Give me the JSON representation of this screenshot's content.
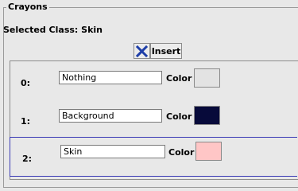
{
  "group": {
    "title": "Crayons"
  },
  "selected_class": "Selected Class: Skin",
  "toolbar": {
    "delete_icon": "close-x-icon",
    "insert_label": "Insert",
    "icon_color": "#1f3fa8"
  },
  "crayons": [
    {
      "index": "0:",
      "name": "Nothing",
      "color_label": "Color",
      "swatch_color": "#e3e3e3"
    },
    {
      "index": "1:",
      "name": "Background",
      "color_label": "Color",
      "swatch_color": "#070a3a"
    },
    {
      "index": "2:",
      "name": "Skin",
      "color_label": "Color",
      "swatch_color": "#ffc6c6"
    }
  ],
  "selected_row_color": "#3b3bb5"
}
